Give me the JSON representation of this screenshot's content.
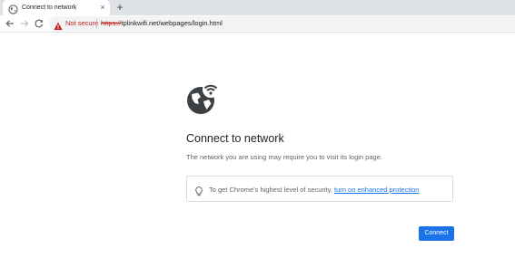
{
  "tab": {
    "title": "Connect to network",
    "favicon": "globe-icon",
    "close_glyph": "×"
  },
  "new_tab_glyph": "+",
  "toolbar": {
    "back_icon": "back-arrow-icon",
    "forward_icon": "forward-arrow-icon",
    "reload_icon": "reload-icon",
    "security_label": "Not secure",
    "url_scheme": "https://",
    "url_rest": "tplinkwifi.net/webpages/login.html"
  },
  "content": {
    "icon": "globe-wifi-icon",
    "title": "Connect to network",
    "description": "The network you are using may require you to visit its login page.",
    "tip": {
      "icon": "lightbulb-icon",
      "text": "To get Chrome's highest level of security, ",
      "link": "turn on enhanced protection"
    },
    "button_label": "Connect"
  },
  "colors": {
    "accent": "#1a73e8",
    "warning": "#c5221f",
    "tab_strip": "#dee1e6",
    "icon_dark": "#3c4043"
  }
}
